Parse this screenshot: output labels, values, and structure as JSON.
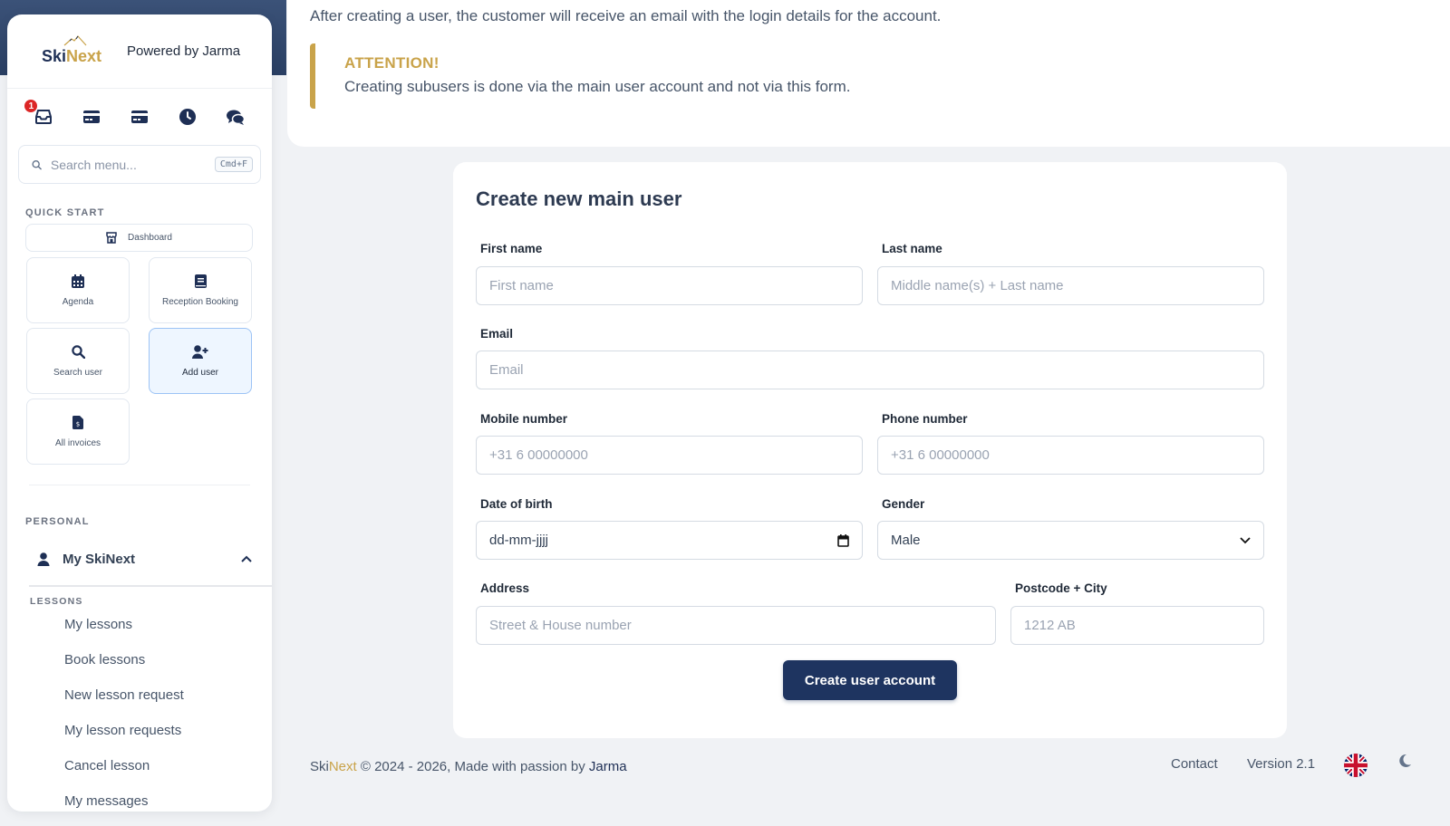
{
  "sidebar": {
    "logo_ski": "Ski",
    "logo_next": "Next",
    "powered": "Powered by Jarma",
    "badge": "1",
    "icons": [
      "inbox-icon",
      "credit-card-icon",
      "credit-card-icon",
      "clock-icon",
      "chat-icon"
    ],
    "search_placeholder": "Search menu...",
    "search_shortcut": "Cmd+F",
    "quick_start": "QUICK START",
    "dashboard": "Dashboard",
    "quick": [
      "Agenda",
      "Reception Booking",
      "Search user",
      "Add user",
      "All invoices"
    ],
    "personal": "PERSONAL",
    "my_skinext": "My SkiNext",
    "lessons": "LESSONS",
    "lesson_links": [
      "My lessons",
      "Book lessons",
      "New lesson request",
      "My lesson requests",
      "Cancel lesson",
      "My messages"
    ]
  },
  "notice": {
    "intro": "After creating a user, the customer will receive an email with the login details for the account.",
    "title": "ATTENTION!",
    "text": "Creating subusers is done via the main user account and not via this form."
  },
  "form": {
    "title": "Create new main user",
    "first_name_label": "First name",
    "first_name_ph": "First name",
    "last_name_label": "Last name",
    "last_name_ph": "Middle name(s) + Last name",
    "email_label": "Email",
    "email_ph": "Email",
    "mobile_label": "Mobile number",
    "mobile_ph": "+31 6 00000000",
    "phone_label": "Phone number",
    "phone_ph": "+31 6 00000000",
    "dob_label": "Date of birth",
    "dob_value": "dd-mm-jjjj",
    "gender_label": "Gender",
    "gender_value": "Male",
    "address_label": "Address",
    "address_ph": "Street & House number",
    "postcode_label": "Postcode + City",
    "postcode_ph": "1212 AB",
    "submit": "Create user account"
  },
  "footer": {
    "ski": "Ski",
    "next": "Next",
    "copy": " © 2024 - 2026, Made with passion by ",
    "author": "Jarma",
    "contact": "Contact",
    "version": "Version 2.1"
  },
  "colors": {
    "navy": "#1e3460",
    "gold": "#c9a34a",
    "badge": "#dc2626"
  }
}
